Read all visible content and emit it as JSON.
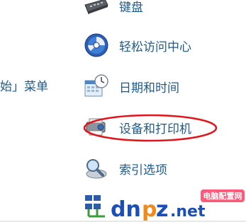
{
  "control_panel": {
    "left_partial_label": "始」菜单",
    "items": [
      {
        "label": "键盘",
        "icon": "keyboard-icon"
      },
      {
        "label": "轻松访问中心",
        "icon": "ease-of-access-icon"
      },
      {
        "label": "日期和时间",
        "icon": "date-time-icon"
      },
      {
        "label": "设备和打印机",
        "icon": "devices-printers-icon"
      },
      {
        "label": "索引选项",
        "icon": "indexing-options-icon"
      }
    ]
  },
  "highlight": {
    "target": "设备和打印机",
    "color": "#e0141a"
  },
  "watermark": {
    "site_letters": "dnpz",
    "site_suffix": ".net",
    "badge_text": "电脑配置网",
    "colors": {
      "blue": "#1b4fb8",
      "orange": "#f08a1c",
      "badge_bg": "#ff5a7a"
    }
  }
}
